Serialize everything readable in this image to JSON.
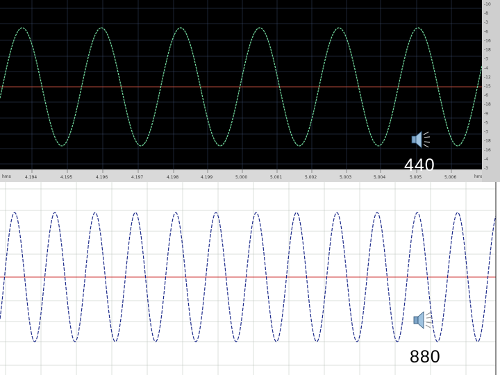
{
  "top_panel": {
    "frequency_label": "440",
    "time_axis_unit": "hms",
    "time_axis_unit_right": "hms",
    "time_ticks": [
      "4.194",
      "4.195",
      "4.196",
      "4.197",
      "4.198",
      "4.199",
      "5.000",
      "5.001",
      "5.002",
      "5.003",
      "5.004",
      "5.005",
      "5.006"
    ],
    "right_scale": [
      "-10",
      "-8",
      "-3",
      "-6",
      "-16",
      "-18",
      "-3",
      "-4",
      "-12",
      "-15",
      "-6",
      "-18",
      "-9",
      "-5",
      "-3",
      "-18",
      "-16",
      "-4",
      "-3"
    ],
    "colors": {
      "background": "#000000",
      "wave": "#6fd39a",
      "grid": "#3a4a6a",
      "midline": "#b84a3a"
    },
    "visible_cycles": 6
  },
  "bottom_panel": {
    "frequency_label": "880",
    "visible_cycles": 12,
    "colors": {
      "background": "#ffffff",
      "wave": "#1c2a8a",
      "grid": "#b8c0b8",
      "midline": "#cc3333"
    }
  },
  "icons": {
    "top_speaker": "speaker-icon",
    "bottom_speaker": "speaker-icon"
  }
}
